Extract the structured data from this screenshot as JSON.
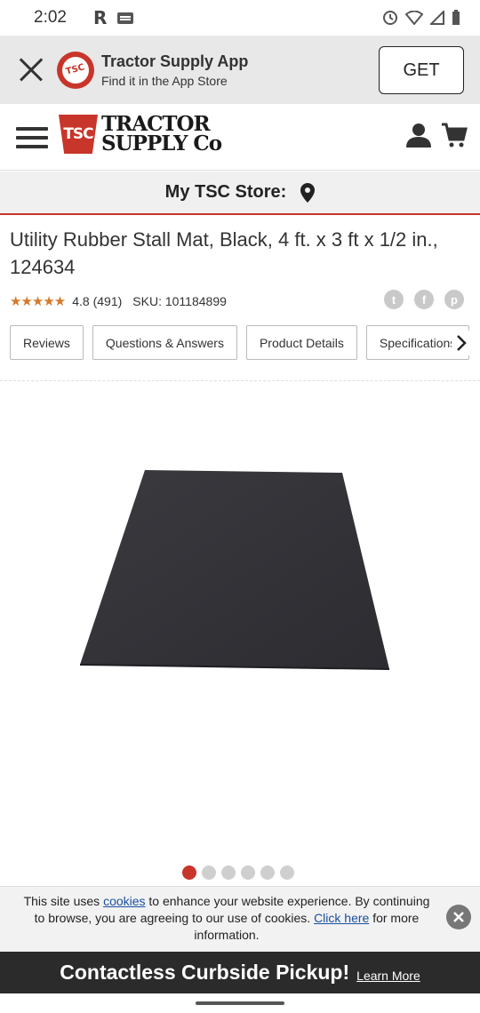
{
  "status_bar": {
    "time": "2:02",
    "r_label": "R",
    "icons": [
      "ge-icon",
      "sync-icon",
      "wifi-icon",
      "signal-icon",
      "battery-icon"
    ]
  },
  "app_banner": {
    "title": "Tractor Supply App",
    "subtitle": "Find it in the App Store",
    "get_label": "GET",
    "logo_text": "TSC"
  },
  "header": {
    "logo_badge": "TSC",
    "logo_line1": "TRACTOR",
    "logo_line2": "SUPPLY Co"
  },
  "store_bar": {
    "label": "My TSC Store:"
  },
  "product": {
    "title": "Utility Rubber Stall Mat, Black, 4 ft. x 3 ft x 1/2 in., 124634",
    "stars": "★★★★★",
    "rating_value": 4.8,
    "rating": "4.8 (491)",
    "sku": "SKU: 101184899"
  },
  "social": {
    "twitter_glyph": "t",
    "facebook_glyph": "f",
    "pinterest_glyph": "p"
  },
  "tabs": [
    {
      "label": "Reviews"
    },
    {
      "label": "Questions & Answers"
    },
    {
      "label": "Product Details"
    },
    {
      "label": "Specifications"
    }
  ],
  "carousel": {
    "count": 6,
    "active_index": 0
  },
  "cookie_notice": {
    "text_1": "This site uses ",
    "link_cookies": "cookies",
    "text_2": " to enhance your website experience. By continuing to browse, you are agreeing to our use of cookies. ",
    "link_click_here": "Click here",
    "text_3": " for more information."
  },
  "curbside": {
    "title": "Contactless Curbside Pickup!",
    "link": "Learn More"
  },
  "colors": {
    "brand_red": "#c8352a",
    "star_orange": "#d47a2a",
    "curbside_bg": "#2b2b2b",
    "link_blue": "#1a4fa0"
  }
}
